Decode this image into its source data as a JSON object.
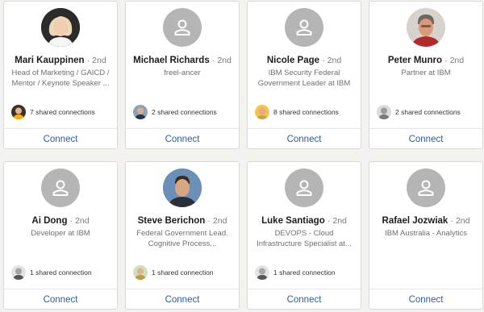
{
  "cards": [
    {
      "name": "Mari Kauppinen",
      "degree": "· 2nd",
      "headline": "Head of Marketing / GAICD / Mentor / Keynote Speaker ...",
      "shared": "7 shared connections",
      "connect": "Connect",
      "avatar_icon": "profile-photo"
    },
    {
      "name": "Michael Richards",
      "degree": "· 2nd",
      "headline": "freel-ancer",
      "shared": "2 shared connections",
      "connect": "Connect",
      "avatar_icon": "placeholder-person-icon"
    },
    {
      "name": "Nicole Page",
      "degree": "· 2nd",
      "headline": "IBM Security Federal Government Leader at IBM",
      "shared": "8 shared connections",
      "connect": "Connect",
      "avatar_icon": "placeholder-person-icon"
    },
    {
      "name": "Peter Munro",
      "degree": "· 2nd",
      "headline": "Partner at IBM",
      "shared": "2 shared connections",
      "connect": "Connect",
      "avatar_icon": "profile-photo"
    },
    {
      "name": "Ai Dong",
      "degree": "· 2nd",
      "headline": "Developer at IBM",
      "shared": "1 shared connection",
      "connect": "Connect",
      "avatar_icon": "placeholder-person-icon"
    },
    {
      "name": "Steve Berichon",
      "degree": "· 2nd",
      "headline": "Federal Government Lead. Cognitive Process...",
      "shared": "1 shared connection",
      "connect": "Connect",
      "avatar_icon": "profile-photo"
    },
    {
      "name": "Luke Santiago",
      "degree": "· 2nd",
      "headline": "DEVOPS - Cloud Infrastructure Specialist at...",
      "shared": "1 shared connection",
      "connect": "Connect",
      "avatar_icon": "placeholder-person-icon"
    },
    {
      "name": "Rafael Jozwiak",
      "degree": "· 2nd",
      "headline": "IBM Australia - Analytics",
      "shared": "",
      "connect": "Connect",
      "avatar_icon": "placeholder-person-icon"
    }
  ],
  "colors": {
    "accent": "#2f5c9c",
    "placeholder": "#b5b5b5",
    "background": "#f3f2ef"
  }
}
